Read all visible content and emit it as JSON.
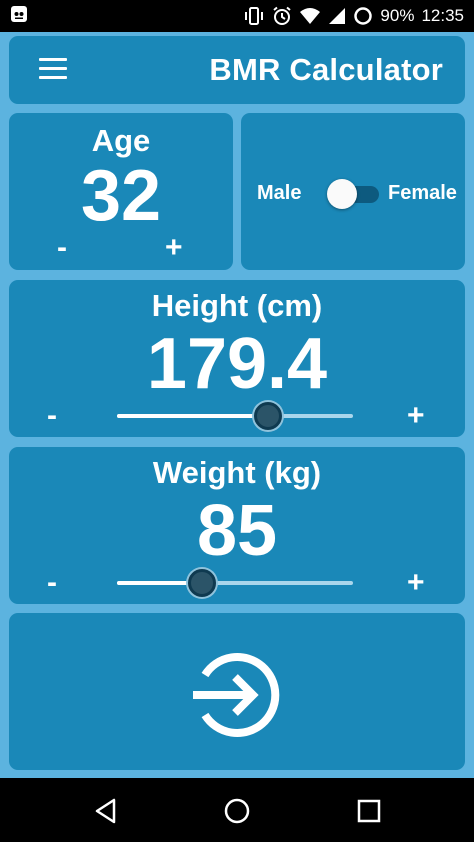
{
  "status_bar": {
    "battery": "90%",
    "time": "12:35",
    "icons": [
      "app-notification-icon",
      "vibrate-icon",
      "alarm-icon",
      "wifi-icon",
      "cell-signal-icon",
      "battery-icon"
    ]
  },
  "toolbar": {
    "title": "BMR Calculator",
    "menu_icon": "hamburger-menu-icon"
  },
  "age": {
    "label": "Age",
    "value": "32",
    "minus": "-",
    "plus": "+"
  },
  "gender": {
    "male_label": "Male",
    "female_label": "Female",
    "selected": "Male"
  },
  "height": {
    "label": "Height (cm)",
    "value": "179.4",
    "minus": "-",
    "plus": "+",
    "slider_fraction": 0.64
  },
  "weight": {
    "label": "Weight (kg)",
    "value": "85",
    "minus": "-",
    "plus": "+",
    "slider_fraction": 0.36
  },
  "calculate": {
    "icon": "sign-in-arrow-icon"
  },
  "nav_bar": {
    "icons": [
      "back-icon",
      "home-icon",
      "recents-icon"
    ]
  },
  "colors": {
    "background": "#5cb3df",
    "card": "#1a88b8",
    "text": "#ffffff"
  }
}
